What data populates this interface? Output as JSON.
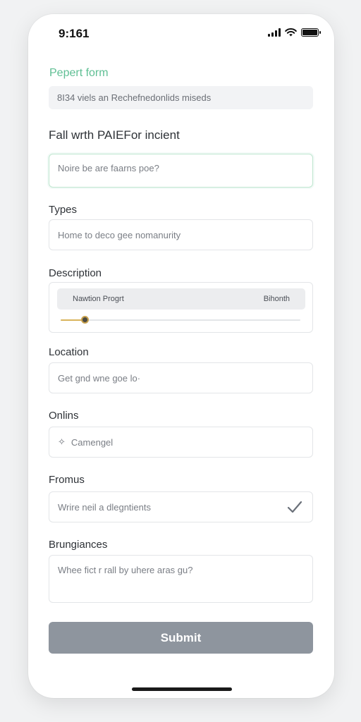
{
  "status_bar": {
    "time": "9:161"
  },
  "form": {
    "title": "Pepert form",
    "banner": "8I34 viels an Rechefnedonlids miseds",
    "heading": "Fall wrth PAIEFor incient",
    "incident_field": {
      "placeholder": "Noire be are faarns poe?"
    },
    "types": {
      "label": "Types",
      "placeholder": "Home to deco gee nomanurity"
    },
    "description": {
      "label": "Description",
      "bar_left": "Nawtion Progrt",
      "bar_right": "Bihonth",
      "slider_level": 0.1
    },
    "location": {
      "label": "Location",
      "placeholder": "Get gnd wne goe lo·"
    },
    "onlins": {
      "label": "Onlins",
      "placeholder": "Camengel",
      "icon": "spark-icon"
    },
    "fromus": {
      "label": "Fromus",
      "placeholder": "Wrire neil a dlegntients",
      "icon": "checkmark-icon"
    },
    "brungiances": {
      "label": "Brungiances",
      "placeholder": "Whee fict r rall by uhere aras gu?"
    },
    "submit_label": "Submit"
  },
  "colors": {
    "accent": "#5fbf94",
    "button": "#8e959e",
    "slider": "#d9b45b"
  }
}
